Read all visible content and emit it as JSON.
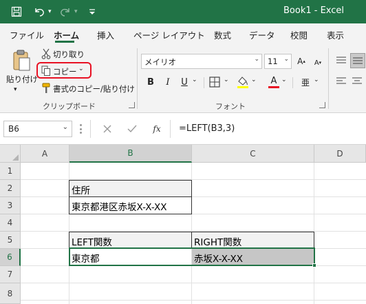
{
  "title": "Book1  -  Excel",
  "colors": {
    "accent": "#217346",
    "highlight_border": "#e81123",
    "font_color_bar": "#e81123"
  },
  "quick_access": {
    "save_icon": "save-icon",
    "undo_icon": "undo-icon",
    "redo_icon": "redo-icon",
    "customize_icon": "customize-qat-icon"
  },
  "tabs": [
    {
      "label": "ファイル",
      "active": false
    },
    {
      "label": "ホーム",
      "active": true
    },
    {
      "label": "挿入",
      "active": false
    },
    {
      "label": "ページ レイアウト",
      "active": false
    },
    {
      "label": "数式",
      "active": false
    },
    {
      "label": "データ",
      "active": false
    },
    {
      "label": "校閲",
      "active": false
    },
    {
      "label": "表示",
      "active": false
    }
  ],
  "clipboard": {
    "paste_label": "貼り付け",
    "cut_label": "切り取り",
    "copy_label": "コピー",
    "format_painter_label": "書式のコピー/貼り付け",
    "group_label": "クリップボード"
  },
  "font": {
    "font_name": "メイリオ",
    "font_size": "11",
    "bold": "B",
    "italic": "I",
    "underline": "U",
    "font_color_glyph": "A",
    "phonetic_glyph": "亜",
    "group_label": "フォント"
  },
  "formula_bar": {
    "name_box": "B6",
    "fx": "fx",
    "formula": "=LEFT(B3,3)"
  },
  "sheet": {
    "columns": [
      "A",
      "B",
      "C",
      "D"
    ],
    "rows": [
      "1",
      "2",
      "3",
      "4",
      "5",
      "6",
      "7",
      "8"
    ],
    "selected_column": "B",
    "selected_row": "6",
    "cells": {
      "B2": "住所",
      "B3": "東京都港区赤坂X-X-XX",
      "B5": "LEFT関数",
      "C5": "RIGHT関数",
      "B6": "東京都",
      "C6": "赤坂X-X-XX"
    }
  }
}
